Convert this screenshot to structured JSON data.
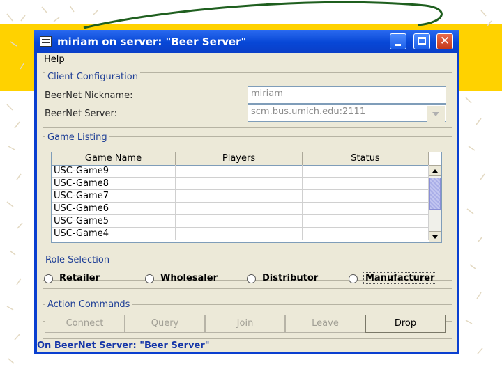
{
  "colors": {
    "slide_yellow": "#ffd200",
    "curve_green": "#1f5f1f",
    "title_blue": "#0a45d4",
    "group_title": "#1f3f96",
    "status_text": "#1737a8"
  },
  "window": {
    "title": "miriam on server: \"Beer Server\"",
    "menu": [
      "Help"
    ],
    "controls": [
      "minimize-icon",
      "maximize-icon",
      "close-icon"
    ]
  },
  "client_config": {
    "title": "Client Configuration",
    "nickname_label": "BeerNet Nickname:",
    "nickname_value": "miriam",
    "server_label": "BeerNet Server:",
    "server_value": "scm.bus.umich.edu:2111"
  },
  "game_listing": {
    "title": "Game Listing",
    "columns": [
      "Game Name",
      "Players",
      "Status"
    ],
    "rows": [
      [
        "USC-Game9",
        "",
        ""
      ],
      [
        "USC-Game8",
        "",
        ""
      ],
      [
        "USC-Game7",
        "",
        ""
      ],
      [
        "USC-Game6",
        "",
        ""
      ],
      [
        "USC-Game5",
        "",
        ""
      ],
      [
        "USC-Game4",
        "",
        ""
      ]
    ]
  },
  "role_selection": {
    "title": "Role Selection",
    "roles": [
      "Retailer",
      "Wholesaler",
      "Distributor",
      "Manufacturer"
    ]
  },
  "action_commands": {
    "title": "Action Commands",
    "buttons": [
      "Connect",
      "Query",
      "Join",
      "Leave",
      "Drop"
    ]
  },
  "status": "On BeerNet Server: \"Beer Server\""
}
